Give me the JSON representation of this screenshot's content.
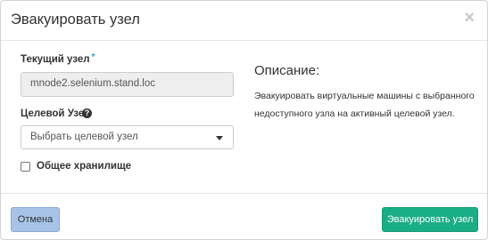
{
  "modal": {
    "title": "Эвакуировать узел",
    "close_glyph": "×"
  },
  "form": {
    "current_node": {
      "label": "Текущий узел",
      "required_mark": "*",
      "value": "mnode2.selenium.stand.loc"
    },
    "target_node": {
      "label": "Целевой Узел",
      "help_glyph": "?",
      "selected": "Выбрать целевой узел"
    },
    "shared_storage": {
      "label": "Общее хранилище",
      "checked": false
    }
  },
  "description": {
    "title": "Описание:",
    "text": "Эвакуировать виртуальные машины с выбранного недоступного узла на активный целевой узел."
  },
  "footer": {
    "cancel_label": "Отмена",
    "submit_label": "Эвакуировать узел"
  },
  "colors": {
    "accent": "#2a9ec9",
    "submit_bg": "#1aae86",
    "cancel_bg": "#a7c4e8"
  }
}
